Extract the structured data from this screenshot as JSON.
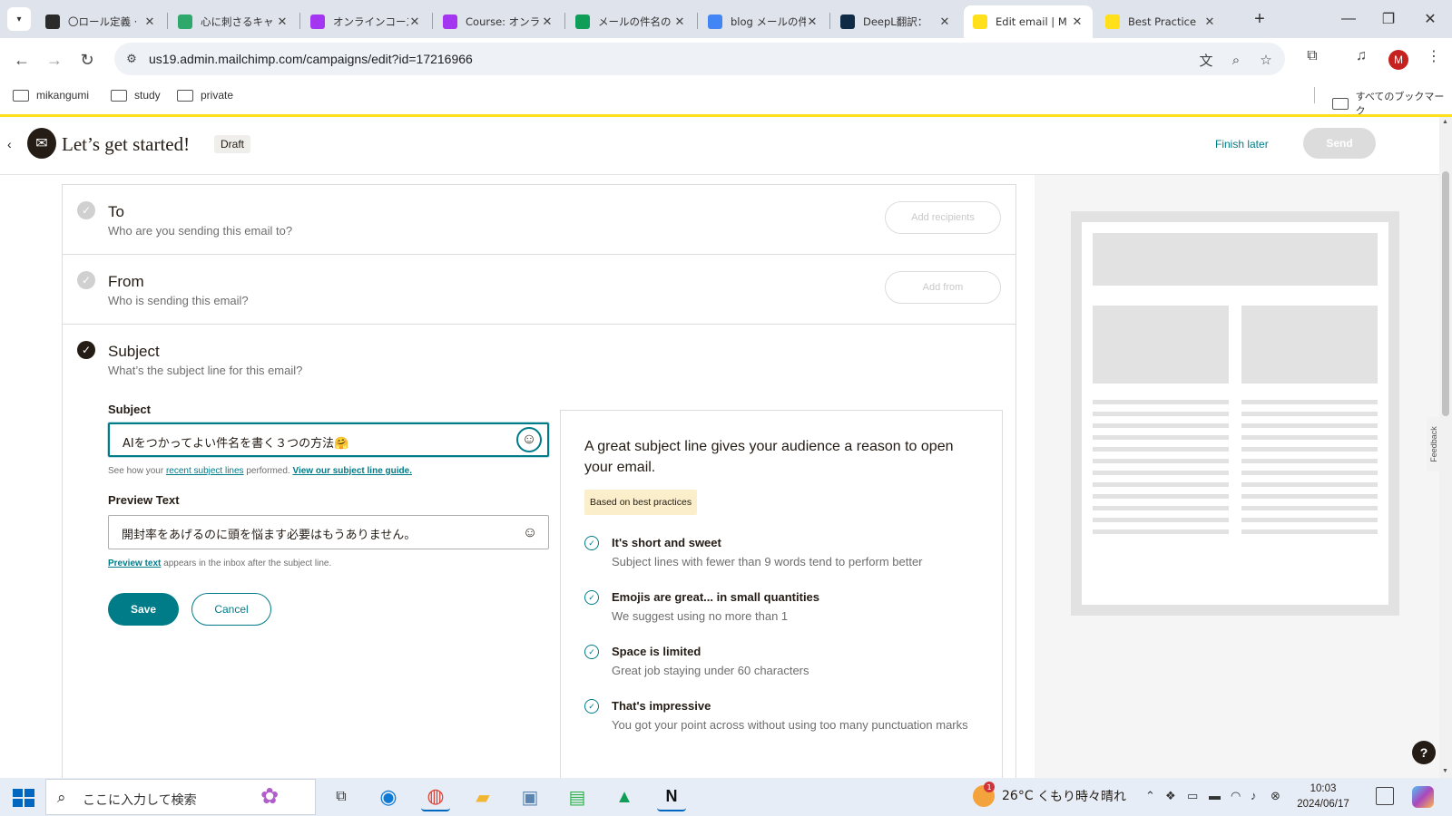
{
  "browser": {
    "tabs": [
      {
        "label": "〇ロール定義 ·",
        "icon": "notion-favicon",
        "color": "#2b2b2b"
      },
      {
        "label": "心に刺さるキャ",
        "icon": "feather-favicon",
        "color": "#2fa86c"
      },
      {
        "label": "オンラインコース",
        "icon": "udemy-favicon",
        "color": "#a435f0"
      },
      {
        "label": "Course: オンラ",
        "icon": "udemy-favicon",
        "color": "#a435f0"
      },
      {
        "label": "メールの件名の",
        "icon": "chat-favicon",
        "color": "#0f9d58"
      },
      {
        "label": "blog メールの件",
        "icon": "docs-favicon",
        "color": "#4285f4"
      },
      {
        "label": "DeepL翻訳：",
        "icon": "deepl-favicon",
        "color": "#0f2b46"
      },
      {
        "label": "Edit email | M",
        "icon": "mailchimp-favicon",
        "color": "#ffe01b",
        "active": true
      },
      {
        "label": "Best Practice",
        "icon": "mailchimp-favicon",
        "color": "#ffe01b"
      }
    ],
    "url": "us19.admin.mailchimp.com/campaigns/edit?id=17216966",
    "profile_initial": "M",
    "bookmarks": [
      "mikangumi",
      "study",
      "private"
    ],
    "all_bookmarks": "すべてのブックマーク"
  },
  "header": {
    "title": "Let’s get started!",
    "badge": "Draft",
    "finish_later": "Finish later",
    "send": "Send"
  },
  "sections": {
    "to": {
      "title": "To",
      "subtitle": "Who are you sending this email to?",
      "action": "Add recipients"
    },
    "from": {
      "title": "From",
      "subtitle": "Who is sending this email?",
      "action": "Add from"
    },
    "subject": {
      "title": "Subject",
      "subtitle": "What’s the subject line for this email?"
    }
  },
  "form": {
    "subject_label": "Subject",
    "subject_value": "AIをつかってよい件名を書く３つの方法🤗",
    "help_prefix": "See how your ",
    "help_link1": "recent subject lines",
    "help_mid": " performed. ",
    "help_link2": "View our subject line guide.",
    "preview_label": "Preview Text",
    "preview_value": "開封率をあげるのに頭を悩ます必要はもうありません。",
    "preview_help_link": "Preview text",
    "preview_help_rest": " appears in the inbox after the subject line.",
    "save": "Save",
    "cancel": "Cancel"
  },
  "tips": {
    "heading": "A great subject line gives your audience a reason to open your email.",
    "badge": "Based on best practices",
    "items": [
      {
        "title": "It's short and sweet",
        "desc": "Subject lines with fewer than 9 words tend to perform better"
      },
      {
        "title": "Emojis are great... in small quantities",
        "desc": "We suggest using no more than 1"
      },
      {
        "title": "Space is limited",
        "desc": "Great job staying under 60 characters"
      },
      {
        "title": "That's impressive",
        "desc": "You got your point across without using too many punctuation marks"
      }
    ]
  },
  "side": {
    "feedback": "Feedback",
    "help": "?"
  },
  "taskbar": {
    "search_placeholder": "ここに入力して検索",
    "weather_temp": "26°C",
    "weather_text": "くもり時々晴れ",
    "weather_badge": "1",
    "time": "10:03",
    "date": "2024/06/17"
  },
  "colors": {
    "accent": "#007c89",
    "brand": "#ffe01b",
    "dark": "#241c15"
  }
}
